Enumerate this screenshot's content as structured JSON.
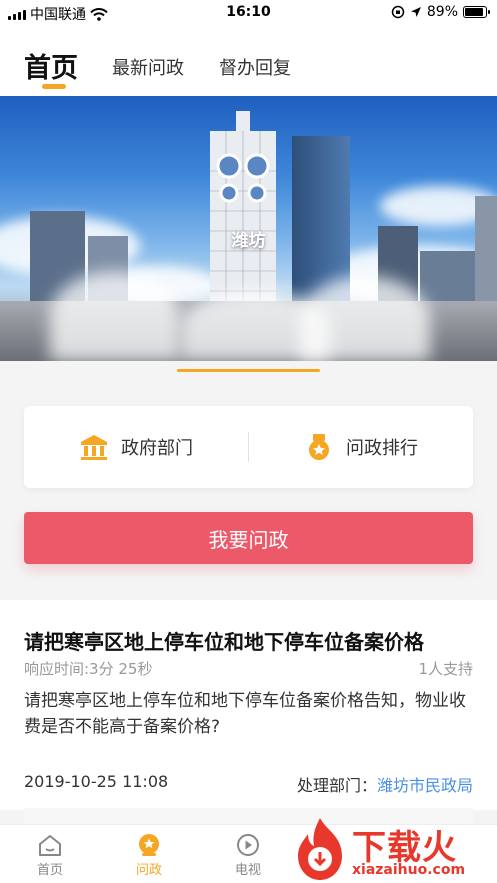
{
  "status_bar": {
    "carrier": "中国联通",
    "time": "16:10",
    "battery": "89%",
    "battery_level": 0.89
  },
  "top_tabs": [
    {
      "label": "首页",
      "active": true
    },
    {
      "label": "最新问政",
      "active": false
    },
    {
      "label": "督办回复",
      "active": false
    }
  ],
  "banner": {
    "caption": "潍坊"
  },
  "quick_links": [
    {
      "label": "政府部门",
      "icon": "government-building-icon"
    },
    {
      "label": "问政排行",
      "icon": "medal-icon"
    }
  ],
  "primary_button": {
    "label": "我要问政"
  },
  "question": {
    "title": "请把寒亭区地上停车位和地下停车位备案价格",
    "response_time": "响应时间:3分 25秒",
    "supporters": "1人支持",
    "body": "请把寒亭区地上停车位和地下停车位备案价格告知，物业收费是否不能高于备案价格?",
    "date": "2019-10-25 11:08",
    "dept_label": "处理部门：",
    "dept": "潍坊市民政局"
  },
  "bottom_tabs": [
    {
      "label": "首页",
      "icon": "home-icon",
      "active": false
    },
    {
      "label": "问政",
      "icon": "ask-icon",
      "active": true
    },
    {
      "label": "电视",
      "icon": "play-icon",
      "active": false
    }
  ],
  "watermark": {
    "text": "下载火",
    "sub": "xiazaihuo.com"
  },
  "colors": {
    "accent": "#f5a623",
    "primary_button": "#ec5a6a",
    "link": "#4a90e2",
    "watermark": "#e8382c"
  }
}
